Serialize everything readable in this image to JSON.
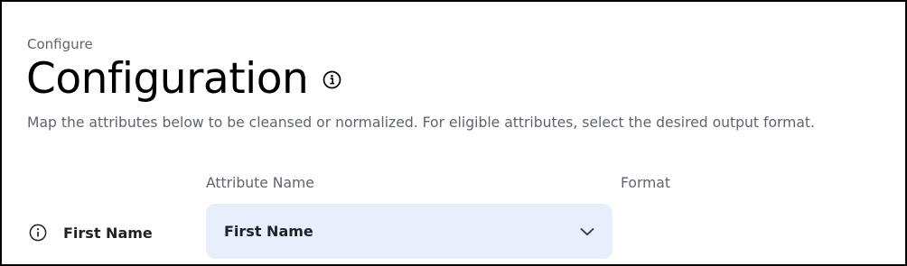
{
  "header": {
    "breadcrumb": "Configure",
    "title": "Configuration",
    "info_icon": "info-icon",
    "description": "Map the attributes below to be cleansed or normalized. For eligible attributes, select the desired output format."
  },
  "table": {
    "columns": [
      "Attribute Name",
      "Format"
    ],
    "rows": [
      {
        "label": "First Name",
        "info_icon": "info-icon",
        "attribute_value": "First Name",
        "dropdown_icon": "chevron-down-icon"
      }
    ]
  },
  "colors": {
    "select_background": "#e8eefb",
    "muted_text": "#5f6470",
    "strong_text": "#1f2128"
  }
}
